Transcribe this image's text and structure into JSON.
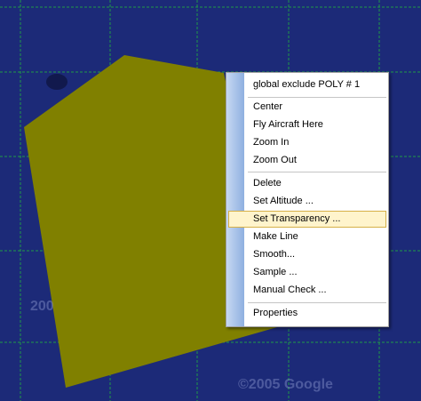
{
  "map": {
    "background_color": "#1c2a78",
    "grid_color": "#1f9a48",
    "polygon_color": "#808000",
    "watermark_copyright": "©2005 Google",
    "watermark_side": "200"
  },
  "context_menu": {
    "items": [
      {
        "label": "global exclude POLY # 1"
      },
      {
        "label": "Center"
      },
      {
        "label": "Fly Aircraft Here"
      },
      {
        "label": "Zoom In"
      },
      {
        "label": "Zoom Out"
      },
      {
        "label": "Delete"
      },
      {
        "label": "Set Altitude ..."
      },
      {
        "label": "Set Transparency ..."
      },
      {
        "label": "Make Line"
      },
      {
        "label": "Smooth..."
      },
      {
        "label": "Sample ..."
      },
      {
        "label": "Manual Check ..."
      },
      {
        "label": "Properties"
      }
    ],
    "highlighted_item": "Set Transparency ..."
  }
}
